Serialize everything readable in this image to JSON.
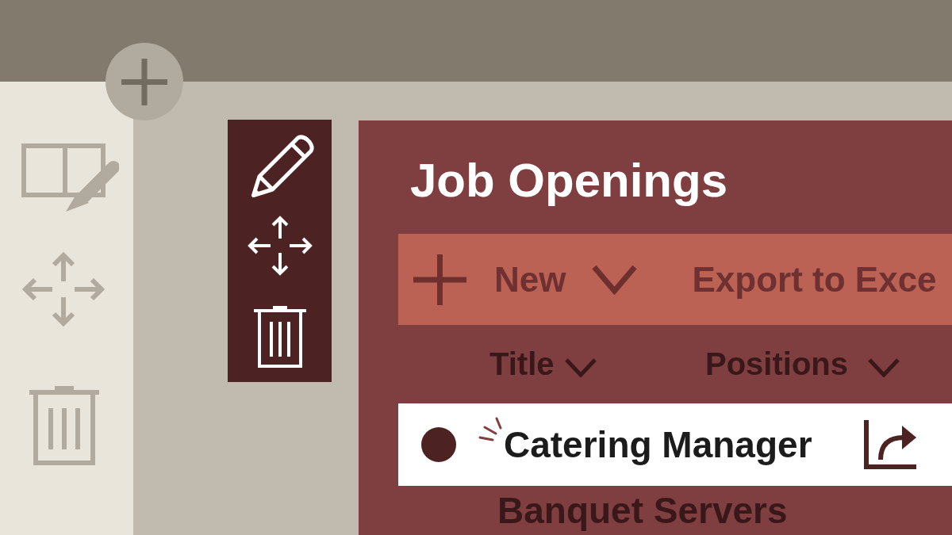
{
  "list": {
    "title": "Job Openings",
    "command_bar": [
      {
        "kind": "dropdown",
        "label": "New"
      },
      {
        "kind": "action",
        "label": "Export to Exce"
      }
    ],
    "columns": [
      "Title",
      "Positions"
    ],
    "rows": [
      {
        "title": "Catering Manager",
        "selected": true
      },
      {
        "title": "Banquet Servers",
        "selected": false
      }
    ]
  }
}
